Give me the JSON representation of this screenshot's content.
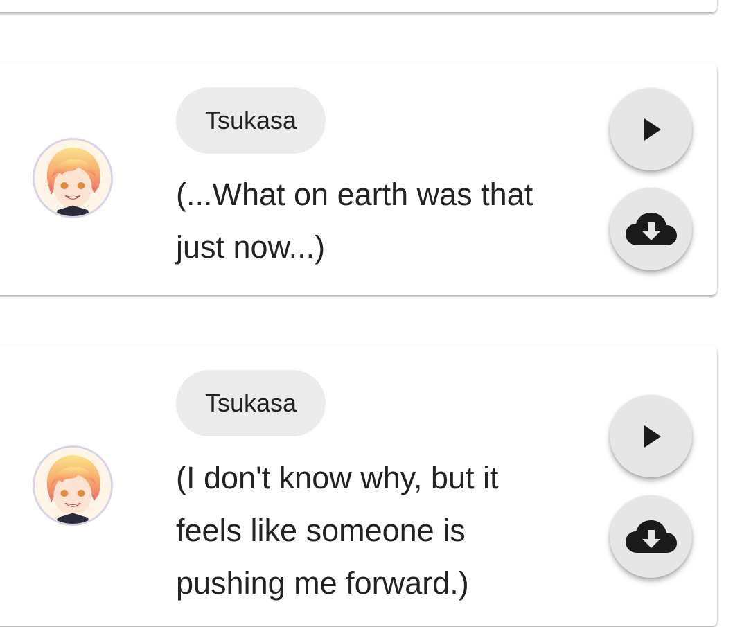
{
  "messages": [
    {
      "speaker": "Tsukasa",
      "text": "(...What on earth was that\njust now...)",
      "avatar_icon": "character-avatar",
      "play_icon": "play-icon",
      "download_icon": "cloud-download-icon"
    },
    {
      "speaker": "Tsukasa",
      "text": "(I don't know why, but it\nfeels like someone is\npushing me forward.)",
      "avatar_icon": "character-avatar",
      "play_icon": "play-icon",
      "download_icon": "cloud-download-icon"
    }
  ],
  "colors": {
    "chip_background": "#ebebeb",
    "fab_background": "#e6e6e6",
    "icon": "#1a1a1a",
    "avatar_ring": "#d9d3e8"
  }
}
